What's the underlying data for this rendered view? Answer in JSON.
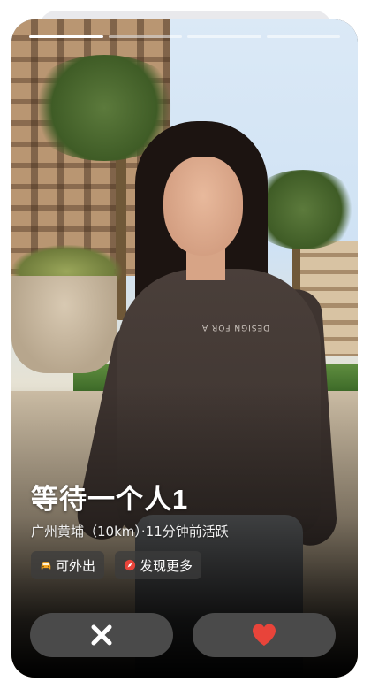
{
  "profile": {
    "name": "等待一个人1",
    "location_line": "广州黄埔（10km）·11分钟前活跃",
    "shirt_print": "DESIGN FOR A"
  },
  "tags": [
    {
      "label": "可外出",
      "icon": "car-icon",
      "color": "#f5a623"
    },
    {
      "label": "发现更多",
      "icon": "compass-icon",
      "color": "#e8443a"
    }
  ],
  "photo_progress": {
    "total": 4,
    "current": 1
  },
  "actions": {
    "dislike_icon": "close-icon",
    "like_icon": "heart-icon",
    "like_color": "#e8443a",
    "button_color": "#4a4a4a"
  }
}
